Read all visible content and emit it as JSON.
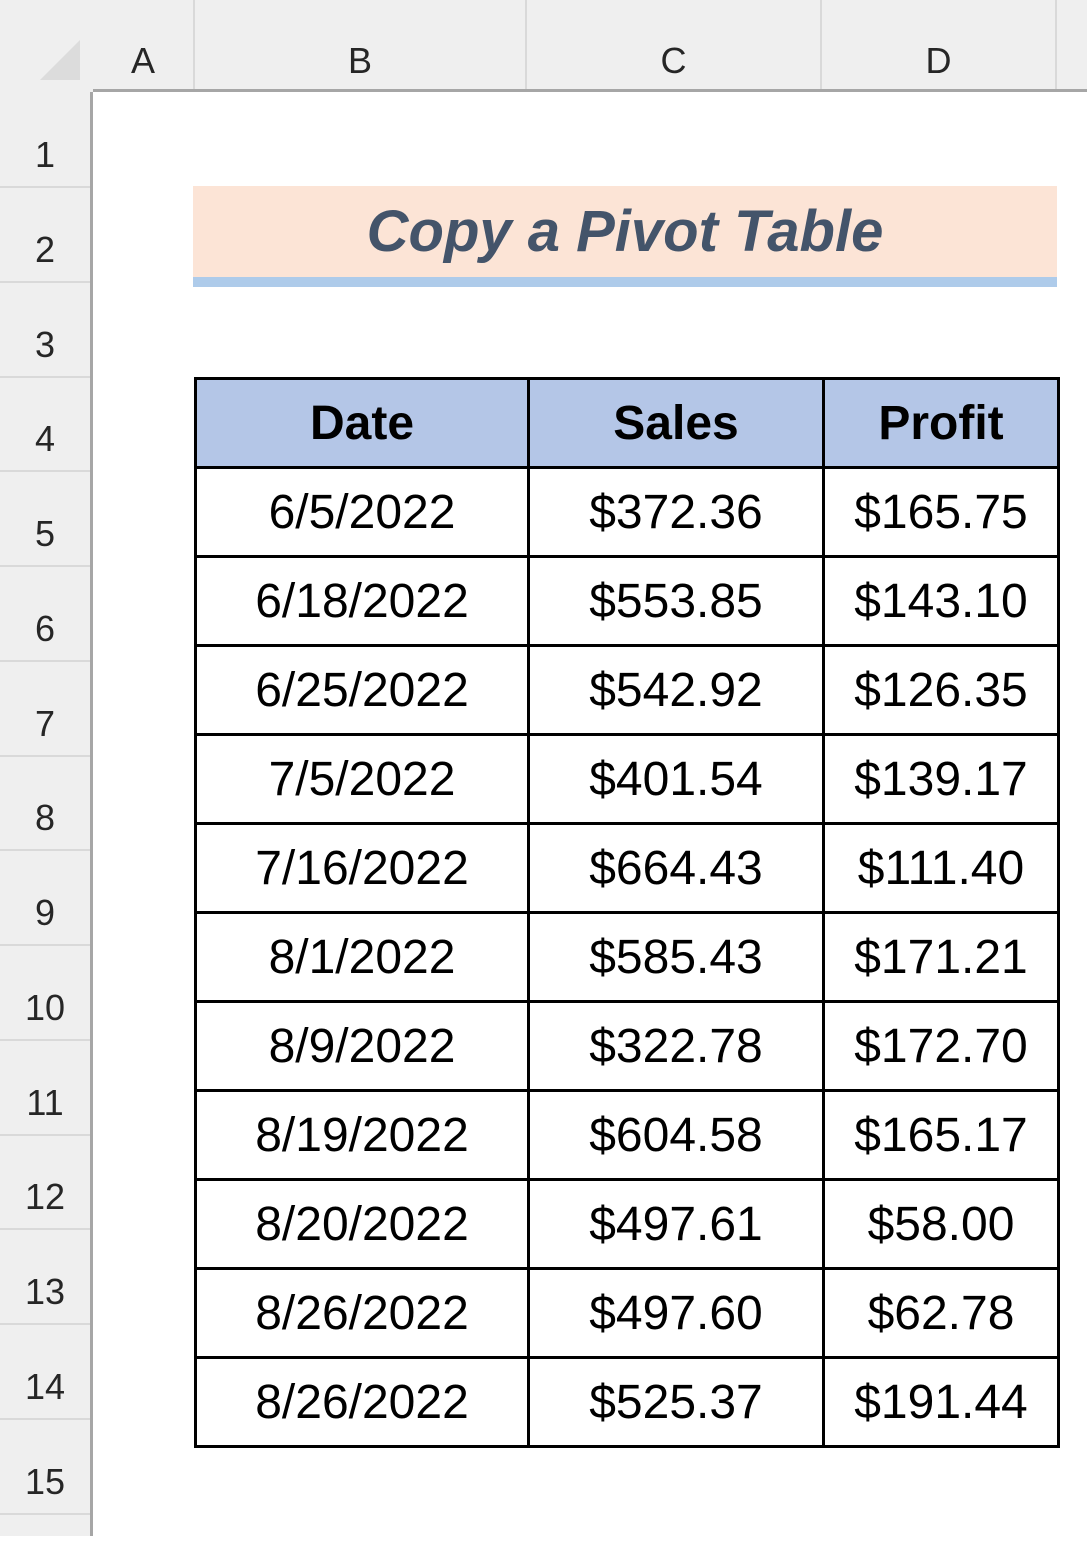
{
  "spreadsheet": {
    "columns": [
      "A",
      "B",
      "C",
      "D"
    ],
    "rows": [
      "1",
      "2",
      "3",
      "4",
      "5",
      "6",
      "7",
      "8",
      "9",
      "10",
      "11",
      "12",
      "13",
      "14",
      "15"
    ],
    "title": "Copy a Pivot Table",
    "table": {
      "headers": [
        "Date",
        "Sales",
        "Profit"
      ],
      "rows": [
        [
          "6/5/2022",
          "$372.36",
          "$165.75"
        ],
        [
          "6/18/2022",
          "$553.85",
          "$143.10"
        ],
        [
          "6/25/2022",
          "$542.92",
          "$126.35"
        ],
        [
          "7/5/2022",
          "$401.54",
          "$139.17"
        ],
        [
          "7/16/2022",
          "$664.43",
          "$111.40"
        ],
        [
          "8/1/2022",
          "$585.43",
          "$171.21"
        ],
        [
          "8/9/2022",
          "$322.78",
          "$172.70"
        ],
        [
          "8/19/2022",
          "$604.58",
          "$165.17"
        ],
        [
          "8/20/2022",
          "$497.61",
          "$58.00"
        ],
        [
          "8/26/2022",
          "$497.60",
          "$62.78"
        ],
        [
          "8/26/2022",
          "$525.37",
          "$191.44"
        ]
      ]
    }
  },
  "colors": {
    "title_fill": "#fce4d6",
    "title_text": "#44546a",
    "title_underline": "#aecbea",
    "table_header_fill": "#b4c6e7"
  }
}
